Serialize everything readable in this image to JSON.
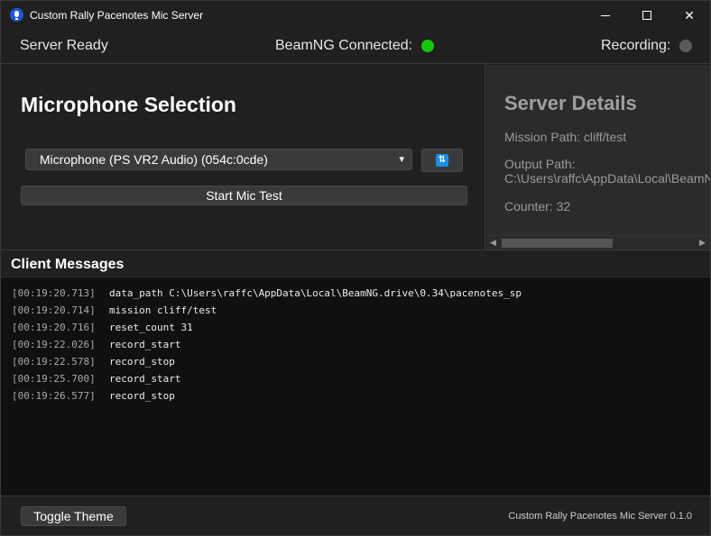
{
  "window": {
    "title": "Custom Rally Pacenotes Mic Server"
  },
  "status": {
    "server": "Server Ready",
    "beamng_label": "BeamNG Connected:",
    "beamng_color": "#16c60c",
    "recording_label": "Recording:",
    "recording_color": "#5a5a5a"
  },
  "mic": {
    "title": "Microphone Selection",
    "selected": "Microphone (PS VR2 Audio) (054c:0cde)",
    "start_label": "Start Mic Test"
  },
  "details": {
    "title": "Server Details",
    "mission": "Mission Path: cliff/test",
    "output_label": "Output Path:",
    "output_value": "C:\\Users\\raffc\\AppData\\Local\\BeamNG",
    "counter": "Counter: 32"
  },
  "messages": {
    "title": "Client Messages",
    "rows": [
      {
        "ts": "[00:19:20.713]",
        "msg": "data_path C:\\Users\\raffc\\AppData\\Local\\BeamNG.drive\\0.34\\pacenotes_sp"
      },
      {
        "ts": "[00:19:20.714]",
        "msg": "mission cliff/test"
      },
      {
        "ts": "[00:19:20.716]",
        "msg": "reset_count 31"
      },
      {
        "ts": "[00:19:22.026]",
        "msg": "record_start"
      },
      {
        "ts": "[00:19:22.578]",
        "msg": "record_stop"
      },
      {
        "ts": "[00:19:25.700]",
        "msg": "record_start"
      },
      {
        "ts": "[00:19:26.577]",
        "msg": "record_stop"
      }
    ]
  },
  "footer": {
    "toggle_label": "Toggle Theme",
    "version": "Custom Rally Pacenotes Mic Server 0.1.0"
  }
}
